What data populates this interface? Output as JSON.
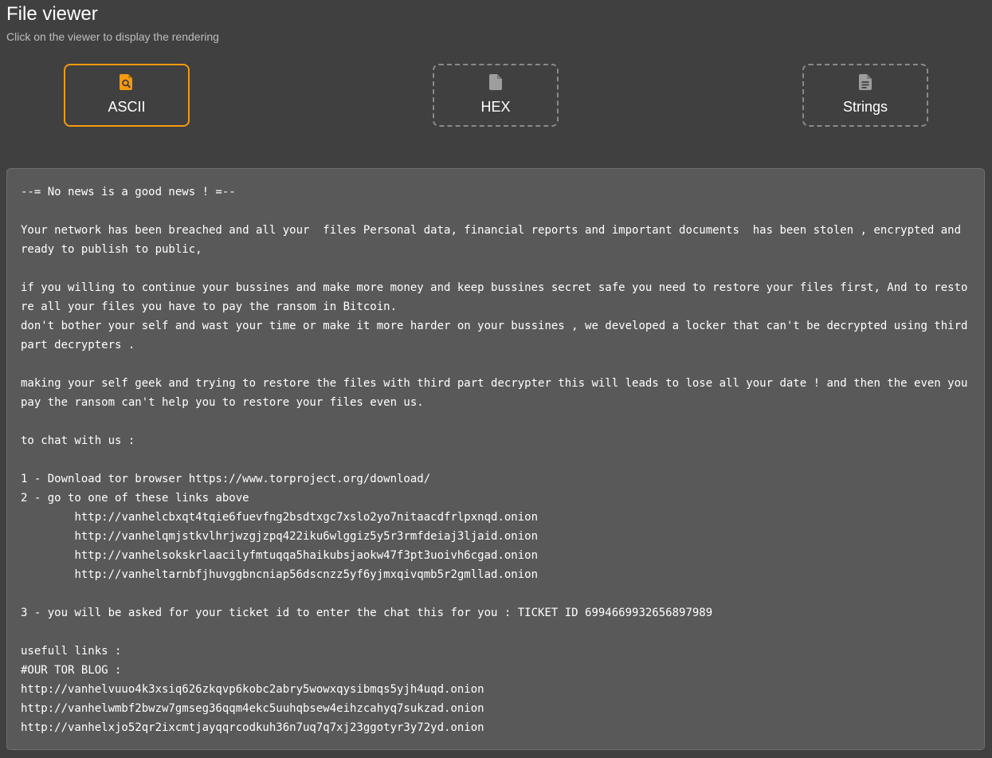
{
  "header": {
    "title": "File viewer",
    "subtitle": "Click on the viewer to display the rendering"
  },
  "viewers": [
    {
      "label": "ASCII",
      "icon": "file-search-icon",
      "active": true
    },
    {
      "label": "HEX",
      "icon": "file-icon",
      "active": false
    },
    {
      "label": "Strings",
      "icon": "file-text-icon",
      "active": false
    }
  ],
  "colors": {
    "accent": "#f59a0c",
    "background": "#404040",
    "panel": "#595959",
    "inactive_border": "#8a8a8a"
  },
  "content": {
    "text": "--= No news is a good news ! =--\n\nYour network has been breached and all your  files Personal data, financial reports and important documents  has been stolen , encrypted and ready to publish to public,\n\nif you willing to continue your bussines and make more money and keep bussines secret safe you need to restore your files first, And to restore all your files you have to pay the ransom in Bitcoin.\ndon't bother your self and wast your time or make it more harder on your bussines , we developed a locker that can't be decrypted using third part decrypters .\n\nmaking your self geek and trying to restore the files with third part decrypter this will leads to lose all your date ! and then the even you pay the ransom can't help you to restore your files even us.\n\nto chat with us :\n\n1 - Download tor browser https://www.torproject.org/download/\n2 - go to one of these links above\n        http://vanhelcbxqt4tqie6fuevfng2bsdtxgc7xslo2yo7nitaacdfrlpxnqd.onion\n        http://vanhelqmjstkvlhrjwzgjzpq422iku6wlggiz5y5r3rmfdeiaj3ljaid.onion\n        http://vanhelsokskrlaacilyfmtuqqa5haikubsjaokw47f3pt3uoivh6cgad.onion\n        http://vanheltarnbfjhuvggbncniap56dscnzz5yf6yjmxqivqmb5r2gmllad.onion\n\n3 - you will be asked for your ticket id to enter the chat this for you : TICKET ID 6994669932656897989\n\nusefull links :\n#OUR TOR BLOG :\nhttp://vanhelvuuo4k3xsiq626zkqvp6kobc2abry5wowxqysibmqs5yjh4uqd.onion\nhttp://vanhelwmbf2bwzw7gmseg36qqm4ekc5uuhqbsew4eihzcahyq7sukzad.onion\nhttp://vanhelxjo52qr2ixcmtjayqqrcodkuh36n7uq7q7xj23ggotyr3y72yd.onion"
  }
}
